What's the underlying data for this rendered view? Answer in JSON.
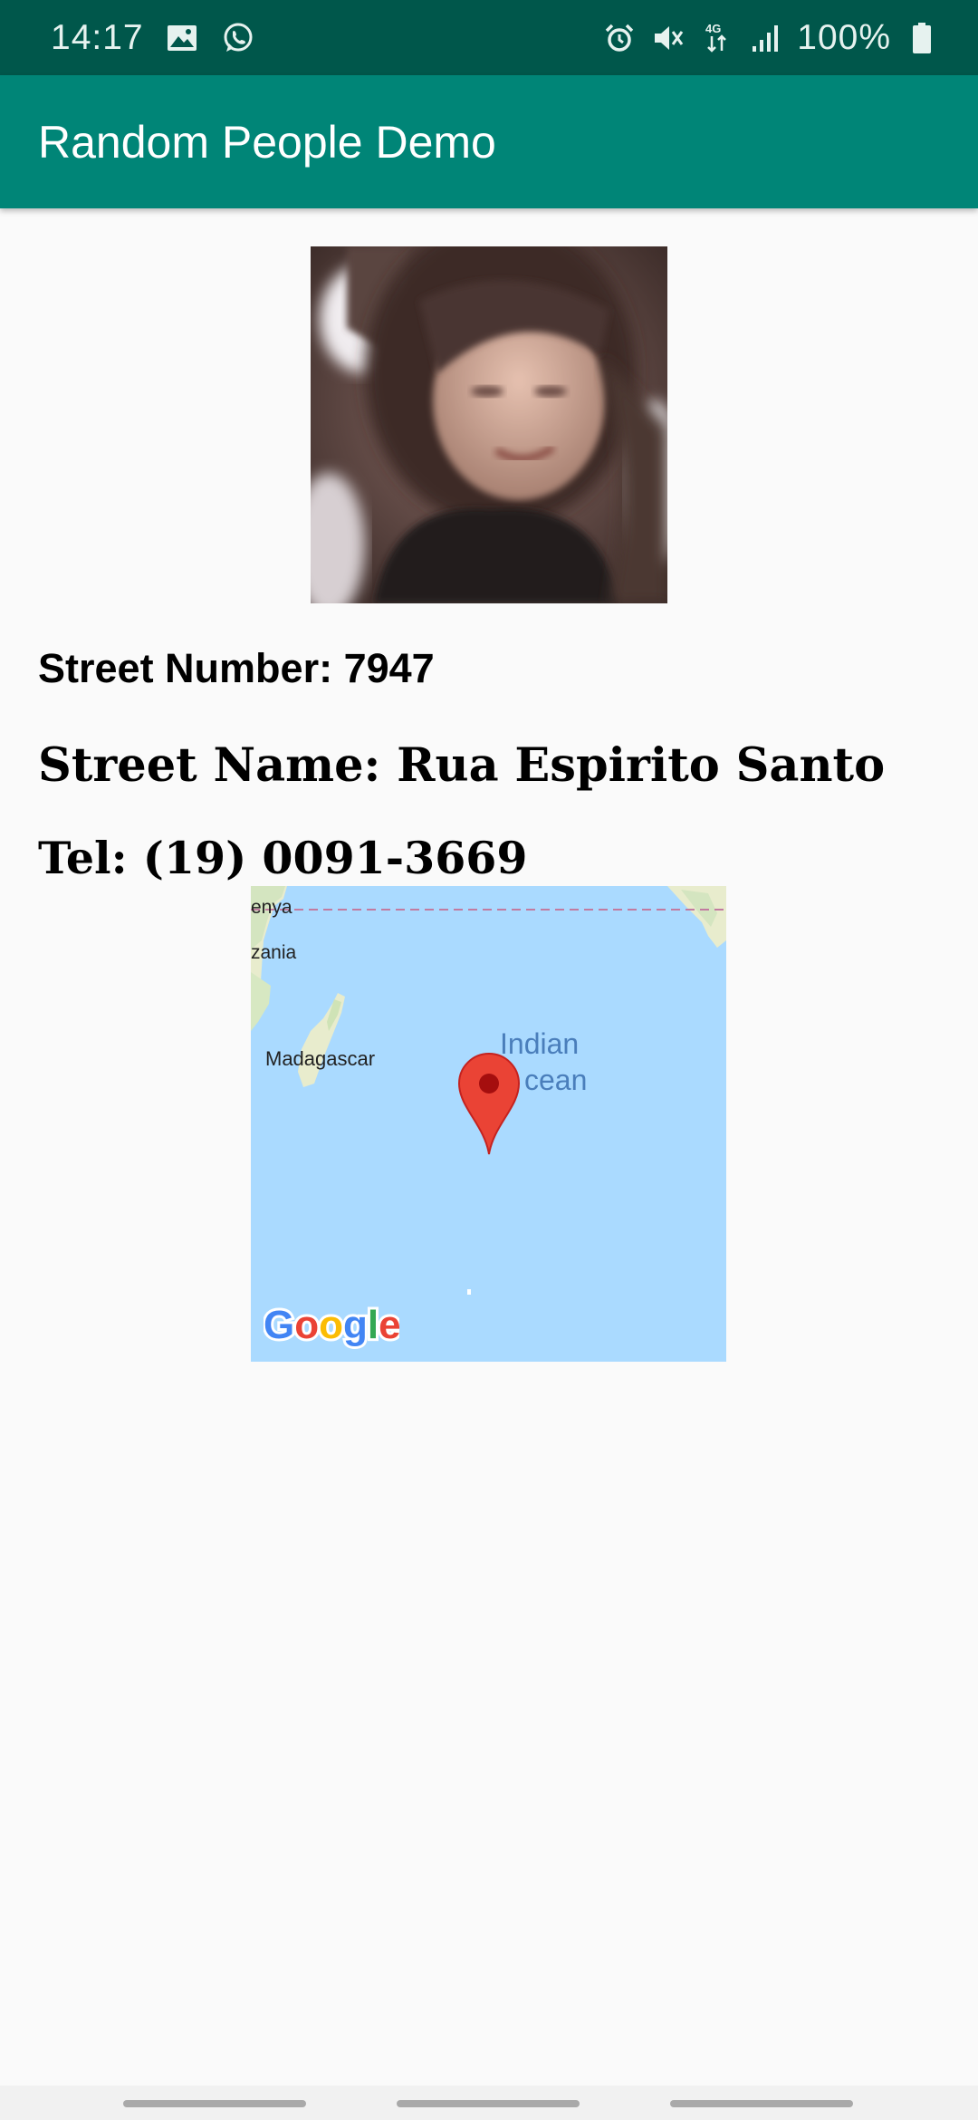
{
  "status_bar": {
    "time": "14:17",
    "battery": "100%",
    "icons": [
      "gallery-icon",
      "whatsapp-icon",
      "alarm-icon",
      "mute-icon",
      "data-4g-icon",
      "signal-icon",
      "battery-icon"
    ]
  },
  "app_bar": {
    "title": "Random People Demo"
  },
  "person": {
    "street_number": "Street Number: 7947",
    "street_name": "Street Name: Rua Espirito Santo",
    "tel": "Tel: (19) 0091-3669"
  },
  "map": {
    "labels": {
      "kenya": "enya",
      "tanzania": "zania",
      "madagascar": "Madagascar",
      "ocean_line1": "Indian",
      "ocean_line2": "cean"
    },
    "logo": "Google",
    "colors": {
      "water": "#aadaff",
      "land": "#e8eccd",
      "pin": "#ea4335"
    }
  },
  "colors": {
    "status_bar": "#00574b",
    "app_bar": "#008577",
    "background": "#fafafa"
  }
}
